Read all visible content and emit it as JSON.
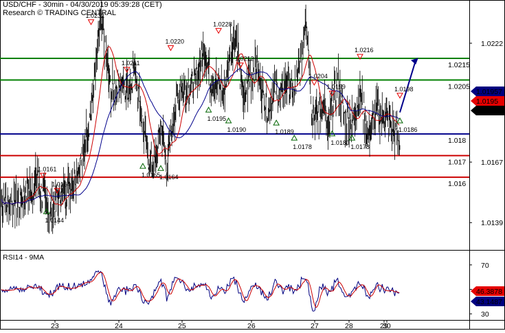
{
  "header": {
    "title": "USD/CHF - 30min - 04/30/2019 05:39:28 (CET)",
    "source": "Research © TRADING CENTRAL"
  },
  "rsi_panel": {
    "label": "RSI14 - 9MA"
  },
  "colors": {
    "price": "#000000",
    "ma_fast": "#cc0000",
    "ma_slow": "#00008b",
    "resistance": "#008000",
    "pivot": "#00008b",
    "support": "#cc0000",
    "forecast": "#00008b",
    "badge_red": "#e60000",
    "badge_black": "#000000",
    "badge_blue": "#000080"
  },
  "chart_data": [
    {
      "type": "line",
      "panel": "price",
      "ylim": [
        1.0127,
        1.0242
      ],
      "y_ticks": [
        "1.0222",
        "1.0167",
        "1.0139"
      ],
      "x_ticks": [
        "23",
        "24",
        "25",
        "26",
        "27",
        "28",
        "29",
        "30"
      ],
      "price_badges": [
        "1.01957",
        "1.0195",
        "1.01913"
      ],
      "levels": [
        {
          "value": 1.0215,
          "label": "1.0215",
          "kind": "resistance"
        },
        {
          "value": 1.0205,
          "label": "1.0205",
          "kind": "resistance"
        },
        {
          "value": 1.018,
          "label": "1.018",
          "kind": "pivot"
        },
        {
          "value": 1.017,
          "label": "1.017",
          "kind": "support"
        },
        {
          "value": 1.016,
          "label": "1.016",
          "kind": "support"
        }
      ],
      "annotations_high": [
        "1.0211",
        "1.0220",
        "1.0228",
        "1.0212",
        "1.0204",
        "1.0199",
        "1.0216",
        "1.0198",
        "1.0161",
        "1.0154",
        "1.0232"
      ],
      "annotations_low": [
        "1.0144",
        "1.0165",
        "1.0164",
        "1.0195",
        "1.0190",
        "1.0189",
        "1.0178",
        "1.0180",
        "1.0178",
        "1.0186"
      ],
      "series": [
        {
          "role": "price",
          "x": [
            0,
            1,
            2,
            3,
            4,
            5,
            6,
            7,
            8,
            9,
            10,
            11,
            12,
            13,
            14,
            15,
            16,
            17,
            18,
            19,
            20,
            21,
            22,
            23,
            24,
            25,
            26,
            27,
            28,
            29,
            30,
            31,
            32,
            33,
            34,
            35,
            36,
            37,
            38,
            39,
            40,
            41,
            42,
            43,
            44,
            45,
            46,
            47,
            48,
            49,
            50,
            51,
            52,
            53,
            54,
            55,
            56,
            57,
            58,
            59,
            60,
            61,
            62,
            63,
            64,
            65,
            66,
            67,
            68,
            69,
            70,
            71,
            72,
            73,
            74,
            75,
            76,
            77,
            78,
            79,
            80,
            81,
            82,
            83,
            84,
            85,
            86,
            87,
            88,
            89,
            90,
            91,
            92,
            93,
            94,
            95,
            96,
            97,
            98,
            99,
            100,
            101,
            102,
            103,
            104,
            105,
            106,
            107,
            108,
            109,
            110,
            111,
            112,
            113,
            114,
            115,
            116,
            117,
            118,
            119,
            120,
            121,
            122,
            123,
            124,
            125,
            126,
            127,
            128,
            129,
            130,
            131,
            132,
            133,
            134,
            135,
            136,
            137,
            138,
            139,
            140,
            141,
            142,
            143,
            144,
            145,
            146,
            147,
            148,
            149,
            150,
            151,
            152,
            153,
            154,
            155,
            156,
            157,
            158,
            159,
            160,
            161,
            162,
            163,
            164,
            165,
            166,
            167,
            168,
            169,
            170,
            171,
            172,
            173,
            174,
            175,
            176,
            177,
            178,
            179,
            180,
            181,
            182,
            183,
            184,
            185,
            186,
            187,
            188,
            189,
            190,
            191,
            192,
            193,
            194,
            195,
            196,
            197,
            198,
            199,
            200,
            201,
            202,
            203,
            204,
            205,
            206,
            207,
            208,
            209,
            210,
            211,
            212,
            213,
            214,
            215,
            216,
            217,
            218,
            219,
            220,
            221,
            222,
            223,
            224,
            225,
            226,
            227,
            228,
            229,
            230,
            231,
            232,
            233,
            234,
            235,
            236,
            237,
            238,
            239,
            240,
            241,
            242,
            243,
            244,
            245,
            246,
            247,
            248,
            249,
            250,
            251,
            252,
            253,
            254,
            255,
            256,
            257,
            258,
            259,
            260,
            261,
            262,
            263,
            264,
            265,
            266,
            267,
            268,
            269,
            270,
            271,
            272,
            273,
            274,
            275,
            276,
            277,
            278,
            279,
            280,
            281,
            282,
            283,
            284,
            285,
            286,
            287,
            288,
            289,
            290,
            291,
            292,
            293,
            294,
            295,
            296,
            297,
            298,
            299,
            300,
            301,
            302,
            303,
            304,
            305,
            306,
            307,
            308,
            309,
            310,
            311,
            312,
            313,
            314,
            315,
            316,
            317,
            318,
            319,
            320,
            321,
            322,
            323,
            324,
            325,
            326,
            327,
            328,
            329,
            330,
            331,
            332,
            333,
            334,
            335,
            336,
            337,
            338,
            339,
            340,
            341,
            342,
            343,
            344,
            345,
            346,
            347,
            348,
            349,
            350,
            351,
            352,
            353,
            354,
            355,
            356,
            357,
            358,
            359,
            360,
            361,
            362,
            363,
            364,
            365,
            366,
            367,
            368,
            369,
            370,
            371,
            372,
            373,
            374,
            375,
            376,
            377,
            378,
            379,
            380,
            381,
            382,
            383,
            384,
            385,
            386,
            387,
            388,
            389,
            390,
            391,
            392,
            393,
            394,
            395,
            396,
            397,
            398,
            399,
            400,
            401,
            402,
            403,
            404,
            405,
            406,
            407,
            408,
            409,
            410,
            411,
            412,
            413,
            414,
            415,
            416,
            417,
            418,
            419,
            420,
            421,
            422,
            423,
            424,
            425,
            426,
            427,
            428,
            429,
            430,
            431,
            432,
            433,
            434,
            435,
            436,
            437,
            438,
            439,
            440,
            441,
            442,
            443,
            444,
            445,
            446,
            447,
            448,
            449,
            450,
            451,
            452,
            453,
            454,
            455,
            456,
            457,
            458,
            459,
            460,
            461,
            462,
            463,
            464,
            465,
            466,
            467,
            468,
            469,
            470,
            471,
            472,
            473,
            474,
            475,
            476,
            477,
            478,
            479,
            480,
            481,
            482,
            483,
            484,
            485,
            486,
            487,
            488,
            489,
            490,
            491,
            492,
            493,
            494,
            495,
            496,
            497,
            498,
            499,
            500,
            501,
            502,
            503,
            504,
            505,
            506,
            507,
            508,
            509,
            510,
            511,
            512,
            513,
            514,
            515,
            516,
            517,
            518,
            519,
            520,
            521,
            522,
            523,
            524,
            525,
            526,
            527,
            528,
            529,
            530,
            531,
            532,
            533,
            534,
            535,
            536,
            537,
            538,
            539,
            540,
            541,
            542,
            543,
            544,
            545,
            546,
            547,
            548,
            549,
            550,
            551,
            552,
            553,
            554,
            555,
            556,
            557,
            558,
            559,
            560,
            561,
            562,
            563,
            564,
            565,
            566,
            567,
            568,
            569,
            570,
            571,
            572,
            573,
            574,
            575,
            576,
            577,
            578,
            579,
            580,
            581,
            582,
            583,
            584,
            585,
            586,
            587,
            588,
            589,
            590,
            591,
            592,
            593,
            594,
            595,
            596,
            597,
            598,
            599,
            600,
            601,
            602,
            603,
            604,
            605,
            606,
            607,
            608,
            609,
            610,
            611,
            612,
            613,
            614,
            615,
            616,
            617,
            618,
            619,
            620,
            621,
            622,
            623,
            624,
            625,
            626,
            627,
            628,
            629,
            630,
            631,
            632,
            633,
            634,
            635,
            636,
            637,
            638,
            639,
            640,
            641,
            642,
            643,
            644,
            645,
            646,
            647,
            648,
            649,
            650,
            651,
            652,
            653,
            654,
            655,
            656,
            657,
            658,
            659,
            660,
            661,
            662,
            663,
            664,
            665,
            666,
            667,
            668,
            669,
            670,
            671,
            672,
            673,
            674,
            675,
            676,
            677,
            678,
            679,
            680,
            681,
            682,
            683,
            684,
            685,
            686,
            687,
            688,
            689,
            690,
            691,
            692,
            693,
            694,
            695,
            696,
            697,
            698,
            699
          ],
          "anchors_x": [
            0.0,
            0.008,
            0.016,
            0.032,
            0.045,
            0.06,
            0.08,
            0.09,
            0.105,
            0.12,
            0.15,
            0.175,
            0.185,
            0.205,
            0.225,
            0.25,
            0.275,
            0.295,
            0.31,
            0.325,
            0.335,
            0.345,
            0.35,
            0.365,
            0.385,
            0.4,
            0.415,
            0.43,
            0.45,
            0.47,
            0.49,
            0.51,
            0.525,
            0.545,
            0.56,
            0.575,
            0.59,
            0.6,
            0.61,
            0.62,
            0.64,
            0.655,
            0.67,
            0.685,
            0.7,
            0.72,
            0.735,
            0.75,
            0.765,
            0.78,
            0.795,
            0.81,
            0.82,
            0.83,
            0.845,
            0.86,
            0.88,
            0.9,
            0.92,
            0.94,
            0.96,
            0.975,
            1.0
          ],
          "anchors_y": [
            1.015,
            1.0149,
            1.0147,
            1.015,
            1.0148,
            1.0153,
            1.0155,
            1.0161,
            1.015,
            1.0144,
            1.0152,
            1.0156,
            1.016,
            1.017,
            1.019,
            1.0232,
            1.02,
            1.0205,
            1.02,
            1.0203,
            1.0211,
            1.0198,
            1.0193,
            1.017,
            1.0165,
            1.0185,
            1.0164,
            1.0185,
            1.0203,
            1.02,
            1.0205,
            1.022,
            1.0205,
            1.0203,
            1.0198,
            1.022,
            1.0228,
            1.0205,
            1.0195,
            1.0205,
            1.0212,
            1.02,
            1.019,
            1.0202,
            1.0198,
            1.0205,
            1.0198,
            1.0212,
            1.0236,
            1.0189,
            1.0188,
            1.0195,
            1.0178,
            1.0193,
            1.0204,
            1.0188,
            1.0185,
            1.0199,
            1.018,
            1.019,
            1.0189,
            1.0185,
            1.0178
          ]
        }
      ]
    },
    {
      "type": "line",
      "panel": "rsi",
      "ylim": [
        25,
        80
      ],
      "y_ticks": [
        "70",
        "50",
        "30"
      ],
      "value_badges": [
        "46.3878",
        "43.1487"
      ]
    }
  ]
}
